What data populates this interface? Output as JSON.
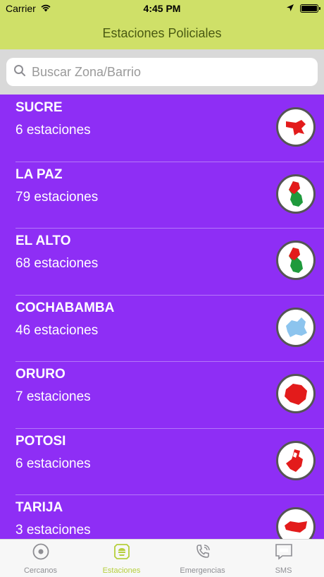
{
  "status_bar": {
    "carrier": "Carrier",
    "time": "4:45 PM"
  },
  "nav": {
    "title": "Estaciones Policiales"
  },
  "search": {
    "placeholder": "Buscar Zona/Barrio",
    "value": ""
  },
  "departments": [
    {
      "name": "SUCRE",
      "count": "6 estaciones",
      "map_icon": "chuquisaca-map-icon",
      "map_color": "#e31b1b"
    },
    {
      "name": "LA PAZ",
      "count": "79 estaciones",
      "map_icon": "la-paz-map-icon",
      "map_color": "#e31b1b"
    },
    {
      "name": "EL ALTO",
      "count": "68 estaciones",
      "map_icon": "el-alto-map-icon",
      "map_color": "#e31b1b"
    },
    {
      "name": "COCHABAMBA",
      "count": "46 estaciones",
      "map_icon": "cochabamba-map-icon",
      "map_color": "#8cc4ee"
    },
    {
      "name": "ORURO",
      "count": "7 estaciones",
      "map_icon": "oruro-map-icon",
      "map_color": "#e31b1b"
    },
    {
      "name": "POTOSI",
      "count": "6 estaciones",
      "map_icon": "potosi-map-icon",
      "map_color": "#e31b1b"
    },
    {
      "name": "TARIJA",
      "count": "3 estaciones",
      "map_icon": "tarija-map-icon",
      "map_color": "#e31b1b"
    }
  ],
  "tabs": [
    {
      "label": "Cercanos",
      "icon": "location-target-icon",
      "active": false
    },
    {
      "label": "Estaciones",
      "icon": "police-badge-icon",
      "active": true
    },
    {
      "label": "Emergencias",
      "icon": "phone-call-icon",
      "active": false
    },
    {
      "label": "SMS",
      "icon": "sms-message-icon",
      "active": false
    }
  ],
  "colors": {
    "header": "#cfe068",
    "list_background": "#8e2ef5",
    "tab_active": "#b6cf3c",
    "tab_inactive": "#8e8e93"
  }
}
